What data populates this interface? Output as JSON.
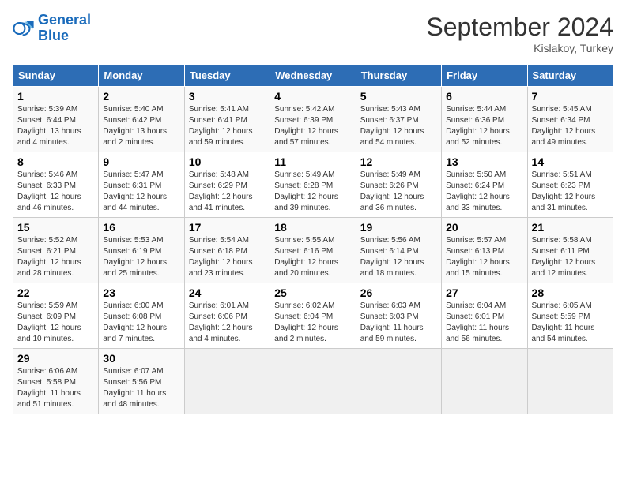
{
  "logo": {
    "line1": "General",
    "line2": "Blue"
  },
  "title": "September 2024",
  "subtitle": "Kislakoy, Turkey",
  "days_header": [
    "Sunday",
    "Monday",
    "Tuesday",
    "Wednesday",
    "Thursday",
    "Friday",
    "Saturday"
  ],
  "weeks": [
    [
      {
        "day": "1",
        "info": "Sunrise: 5:39 AM\nSunset: 6:44 PM\nDaylight: 13 hours\nand 4 minutes."
      },
      {
        "day": "2",
        "info": "Sunrise: 5:40 AM\nSunset: 6:42 PM\nDaylight: 13 hours\nand 2 minutes."
      },
      {
        "day": "3",
        "info": "Sunrise: 5:41 AM\nSunset: 6:41 PM\nDaylight: 12 hours\nand 59 minutes."
      },
      {
        "day": "4",
        "info": "Sunrise: 5:42 AM\nSunset: 6:39 PM\nDaylight: 12 hours\nand 57 minutes."
      },
      {
        "day": "5",
        "info": "Sunrise: 5:43 AM\nSunset: 6:37 PM\nDaylight: 12 hours\nand 54 minutes."
      },
      {
        "day": "6",
        "info": "Sunrise: 5:44 AM\nSunset: 6:36 PM\nDaylight: 12 hours\nand 52 minutes."
      },
      {
        "day": "7",
        "info": "Sunrise: 5:45 AM\nSunset: 6:34 PM\nDaylight: 12 hours\nand 49 minutes."
      }
    ],
    [
      {
        "day": "8",
        "info": "Sunrise: 5:46 AM\nSunset: 6:33 PM\nDaylight: 12 hours\nand 46 minutes."
      },
      {
        "day": "9",
        "info": "Sunrise: 5:47 AM\nSunset: 6:31 PM\nDaylight: 12 hours\nand 44 minutes."
      },
      {
        "day": "10",
        "info": "Sunrise: 5:48 AM\nSunset: 6:29 PM\nDaylight: 12 hours\nand 41 minutes."
      },
      {
        "day": "11",
        "info": "Sunrise: 5:49 AM\nSunset: 6:28 PM\nDaylight: 12 hours\nand 39 minutes."
      },
      {
        "day": "12",
        "info": "Sunrise: 5:49 AM\nSunset: 6:26 PM\nDaylight: 12 hours\nand 36 minutes."
      },
      {
        "day": "13",
        "info": "Sunrise: 5:50 AM\nSunset: 6:24 PM\nDaylight: 12 hours\nand 33 minutes."
      },
      {
        "day": "14",
        "info": "Sunrise: 5:51 AM\nSunset: 6:23 PM\nDaylight: 12 hours\nand 31 minutes."
      }
    ],
    [
      {
        "day": "15",
        "info": "Sunrise: 5:52 AM\nSunset: 6:21 PM\nDaylight: 12 hours\nand 28 minutes."
      },
      {
        "day": "16",
        "info": "Sunrise: 5:53 AM\nSunset: 6:19 PM\nDaylight: 12 hours\nand 25 minutes."
      },
      {
        "day": "17",
        "info": "Sunrise: 5:54 AM\nSunset: 6:18 PM\nDaylight: 12 hours\nand 23 minutes."
      },
      {
        "day": "18",
        "info": "Sunrise: 5:55 AM\nSunset: 6:16 PM\nDaylight: 12 hours\nand 20 minutes."
      },
      {
        "day": "19",
        "info": "Sunrise: 5:56 AM\nSunset: 6:14 PM\nDaylight: 12 hours\nand 18 minutes."
      },
      {
        "day": "20",
        "info": "Sunrise: 5:57 AM\nSunset: 6:13 PM\nDaylight: 12 hours\nand 15 minutes."
      },
      {
        "day": "21",
        "info": "Sunrise: 5:58 AM\nSunset: 6:11 PM\nDaylight: 12 hours\nand 12 minutes."
      }
    ],
    [
      {
        "day": "22",
        "info": "Sunrise: 5:59 AM\nSunset: 6:09 PM\nDaylight: 12 hours\nand 10 minutes."
      },
      {
        "day": "23",
        "info": "Sunrise: 6:00 AM\nSunset: 6:08 PM\nDaylight: 12 hours\nand 7 minutes."
      },
      {
        "day": "24",
        "info": "Sunrise: 6:01 AM\nSunset: 6:06 PM\nDaylight: 12 hours\nand 4 minutes."
      },
      {
        "day": "25",
        "info": "Sunrise: 6:02 AM\nSunset: 6:04 PM\nDaylight: 12 hours\nand 2 minutes."
      },
      {
        "day": "26",
        "info": "Sunrise: 6:03 AM\nSunset: 6:03 PM\nDaylight: 11 hours\nand 59 minutes."
      },
      {
        "day": "27",
        "info": "Sunrise: 6:04 AM\nSunset: 6:01 PM\nDaylight: 11 hours\nand 56 minutes."
      },
      {
        "day": "28",
        "info": "Sunrise: 6:05 AM\nSunset: 5:59 PM\nDaylight: 11 hours\nand 54 minutes."
      }
    ],
    [
      {
        "day": "29",
        "info": "Sunrise: 6:06 AM\nSunset: 5:58 PM\nDaylight: 11 hours\nand 51 minutes."
      },
      {
        "day": "30",
        "info": "Sunrise: 6:07 AM\nSunset: 5:56 PM\nDaylight: 11 hours\nand 48 minutes."
      },
      null,
      null,
      null,
      null,
      null
    ]
  ]
}
